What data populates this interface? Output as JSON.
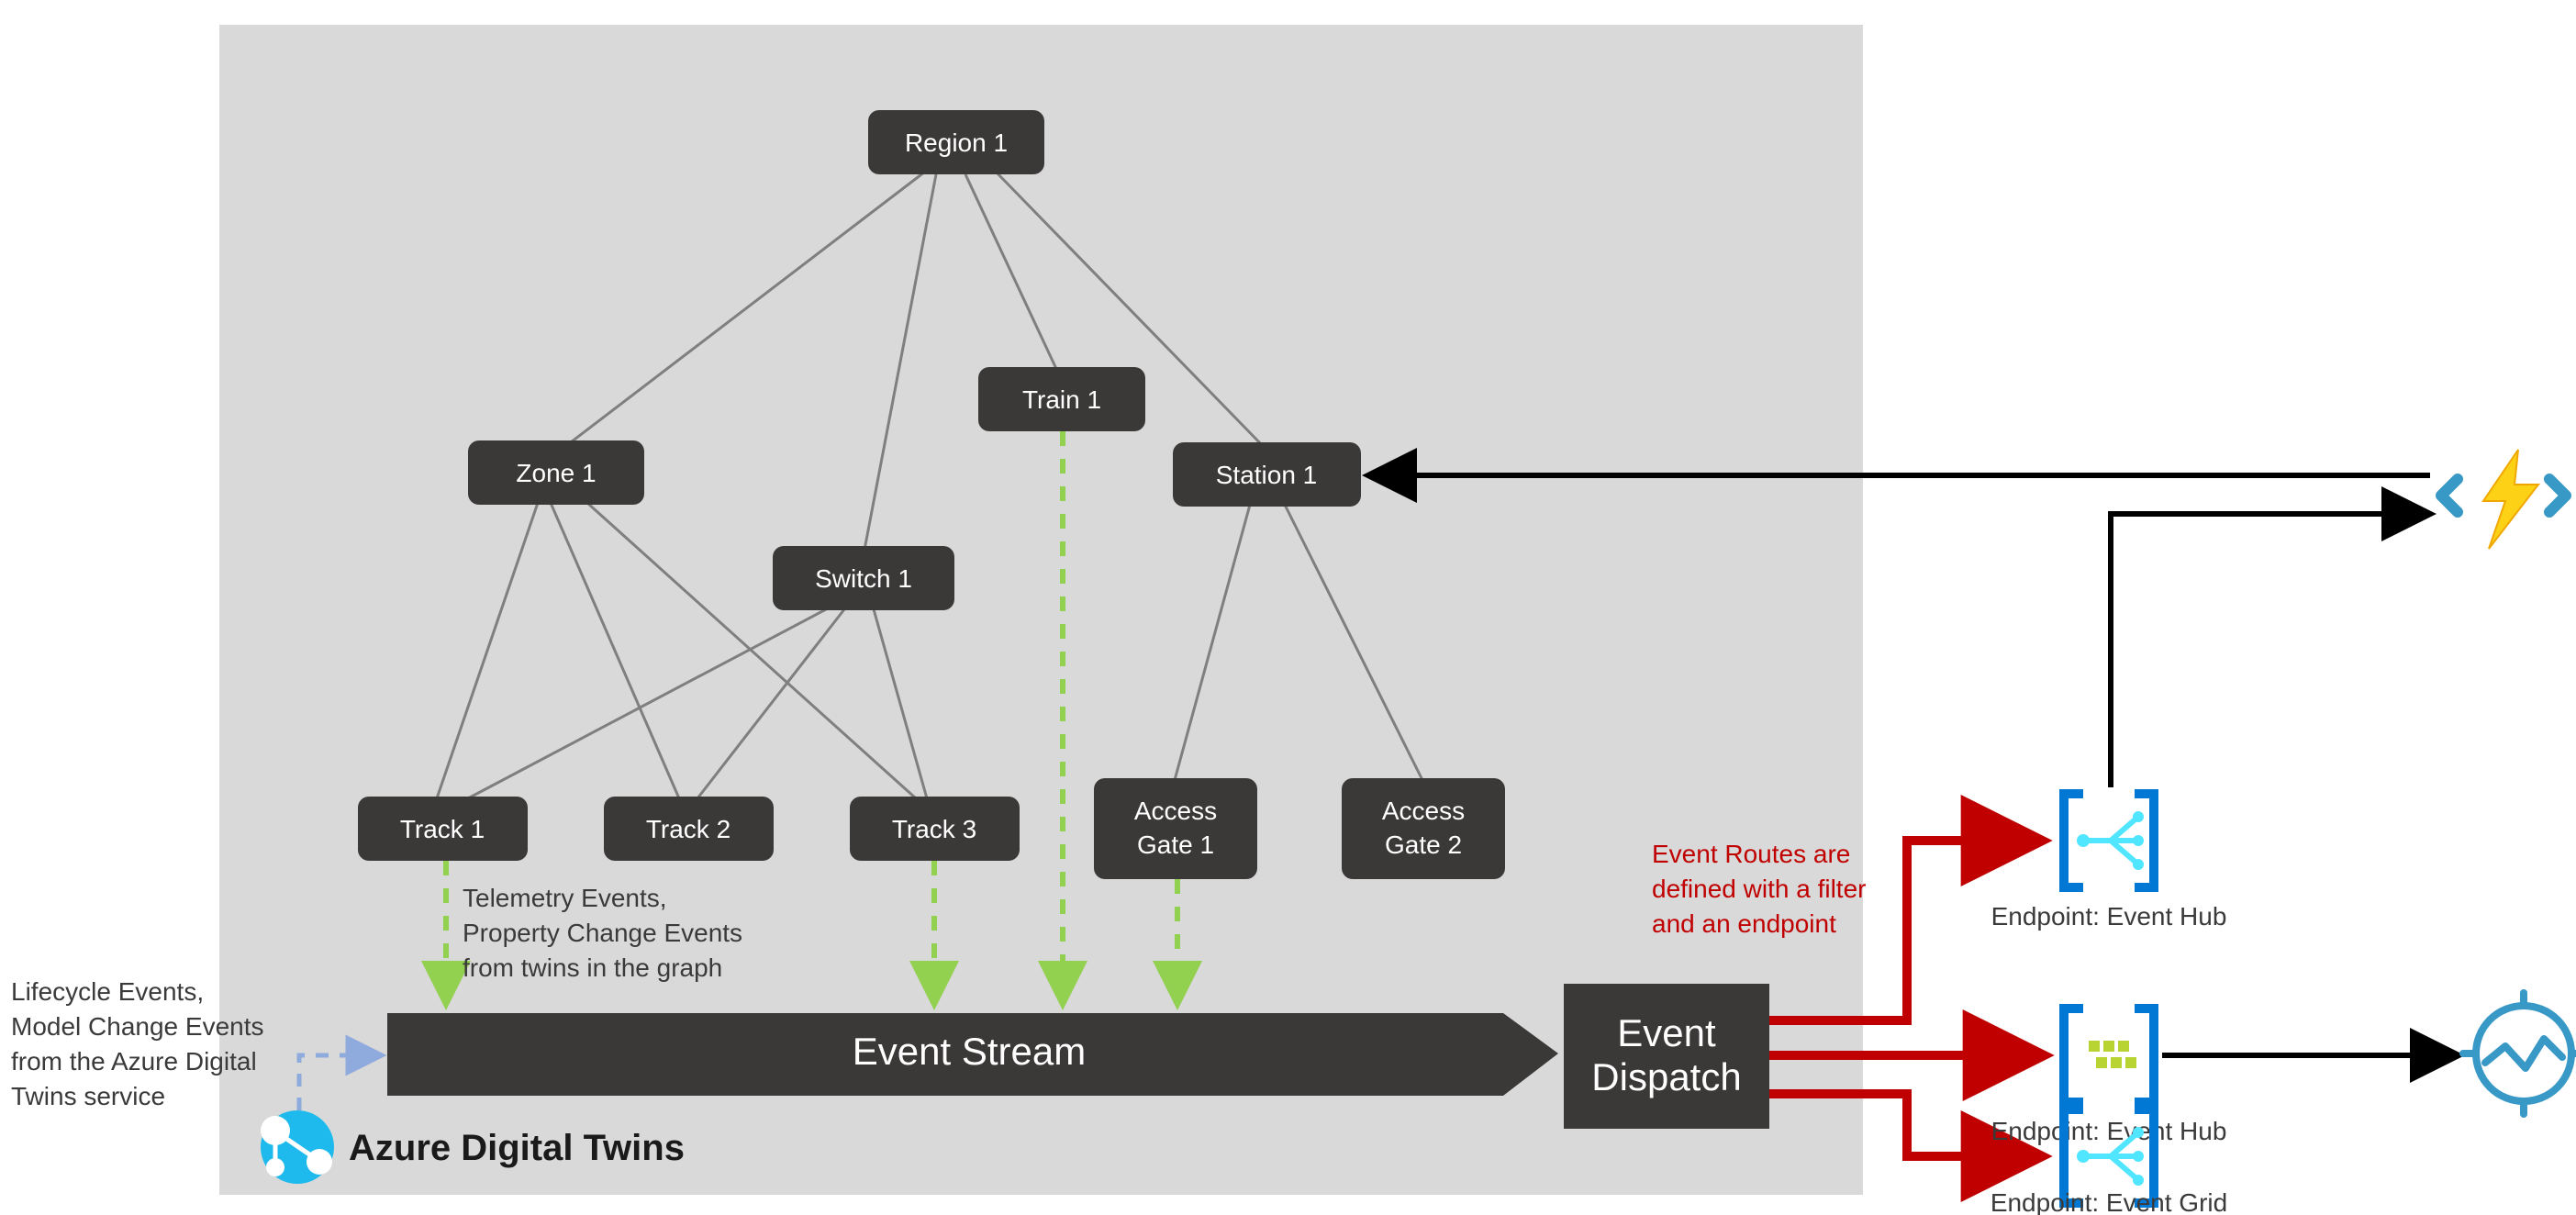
{
  "bgBox": {
    "fill": "#d9d9d9"
  },
  "nodes": {
    "region": "Region 1",
    "zone": "Zone 1",
    "train": "Train 1",
    "station": "Station 1",
    "switch": "Switch 1",
    "track1": "Track 1",
    "track2": "Track 2",
    "track3": "Track 3",
    "gate1a": "Access",
    "gate1b": "Gate 1",
    "gate2a": "Access",
    "gate2b": "Gate 2"
  },
  "stream": {
    "eventStream": "Event Stream",
    "dispatchA": "Event",
    "dispatchB": "Dispatch"
  },
  "notes": {
    "telemetry1": "Telemetry Events,",
    "telemetry2": "Property Change Events",
    "telemetry3": "from twins in the graph",
    "lifecycle1": "Lifecycle Events,",
    "lifecycle2": "Model Change Events",
    "lifecycle3": "from the Azure Digital",
    "lifecycle4": "Twins service",
    "routes1": "Event Routes are",
    "routes2": "defined with a filter",
    "routes3": "and an endpoint"
  },
  "endpoints": {
    "hub1": "Endpoint: Event Hub",
    "hub2": "Endpoint: Event Hub",
    "grid": "Endpoint: Event Grid"
  },
  "adt": {
    "label": "Azure Digital Twins"
  },
  "colors": {
    "nodeFill": "#3b3838",
    "streamFill": "#3b3838",
    "redArrow": "#c00000",
    "blackArrow": "#000000",
    "greenDash": "#92d050",
    "blueDash": "#8faadc",
    "azureBlue": "#0078d4",
    "funcBlue": "#3999c6",
    "funcYellow": "#fcd116",
    "tsiBlue": "#3999c6"
  }
}
